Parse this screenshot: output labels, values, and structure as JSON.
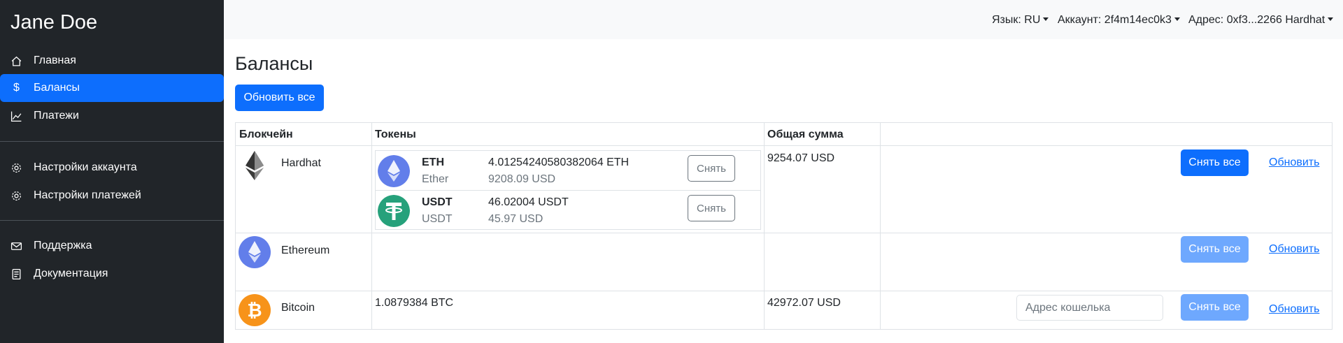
{
  "sidebar": {
    "user_name": "Jane Doe",
    "items": [
      {
        "label": "Главная",
        "icon": "home-icon"
      },
      {
        "label": "Балансы",
        "icon": "dollar-icon",
        "active": true
      },
      {
        "label": "Платежи",
        "icon": "chart-icon"
      },
      {
        "label": "Настройки аккаунта",
        "icon": "gear-icon"
      },
      {
        "label": "Настройки платежей",
        "icon": "gear-icon"
      },
      {
        "label": "Поддержка",
        "icon": "envelope-icon"
      },
      {
        "label": "Документация",
        "icon": "document-icon"
      }
    ]
  },
  "topbar": {
    "language": "Язык: RU",
    "account": "Аккаунт: 2f4m14ec0k3",
    "address": "Адрес: 0xf3...2266 Hardhat"
  },
  "main": {
    "title": "Балансы",
    "refresh_all_label": "Обновить все",
    "columns": [
      "Блокчейн",
      "Токены",
      "Общая сумма",
      ""
    ],
    "rows": [
      {
        "chain": "Hardhat",
        "icon": "ethereum-icon",
        "total": "9254.07 USD",
        "withdraw_all": "Снять все",
        "refresh": "Обновить",
        "tokens": [
          {
            "symbol": "ETH",
            "name": "Ether",
            "amount": "4.01254240580382064 ETH",
            "usd": "9208.09 USD",
            "withdraw": "Снять",
            "icon": "ethereum-icon"
          },
          {
            "symbol": "USDT",
            "name": "USDT",
            "amount": "46.02004 USDT",
            "usd": "45.97 USD",
            "withdraw": "Снять",
            "icon": "tether-icon"
          }
        ]
      },
      {
        "chain": "Ethereum",
        "icon": "ethereum-icon",
        "total": "",
        "withdraw_all": "Снять все",
        "refresh": "Обновить"
      },
      {
        "chain": "Bitcoin",
        "icon": "bitcoin-icon",
        "tokens_text": "1.0879384 BTC",
        "total": "42972.07 USD",
        "wallet_placeholder": "Адрес кошелька",
        "withdraw_all": "Снять все",
        "refresh": "Обновить"
      }
    ]
  },
  "colors": {
    "sidebar_bg": "#212529",
    "primary": "#0d6efd",
    "primary_disabled": "#6ea8fe",
    "eth": "#627eea",
    "usdt": "#26a17b",
    "btc": "#f7931a"
  }
}
